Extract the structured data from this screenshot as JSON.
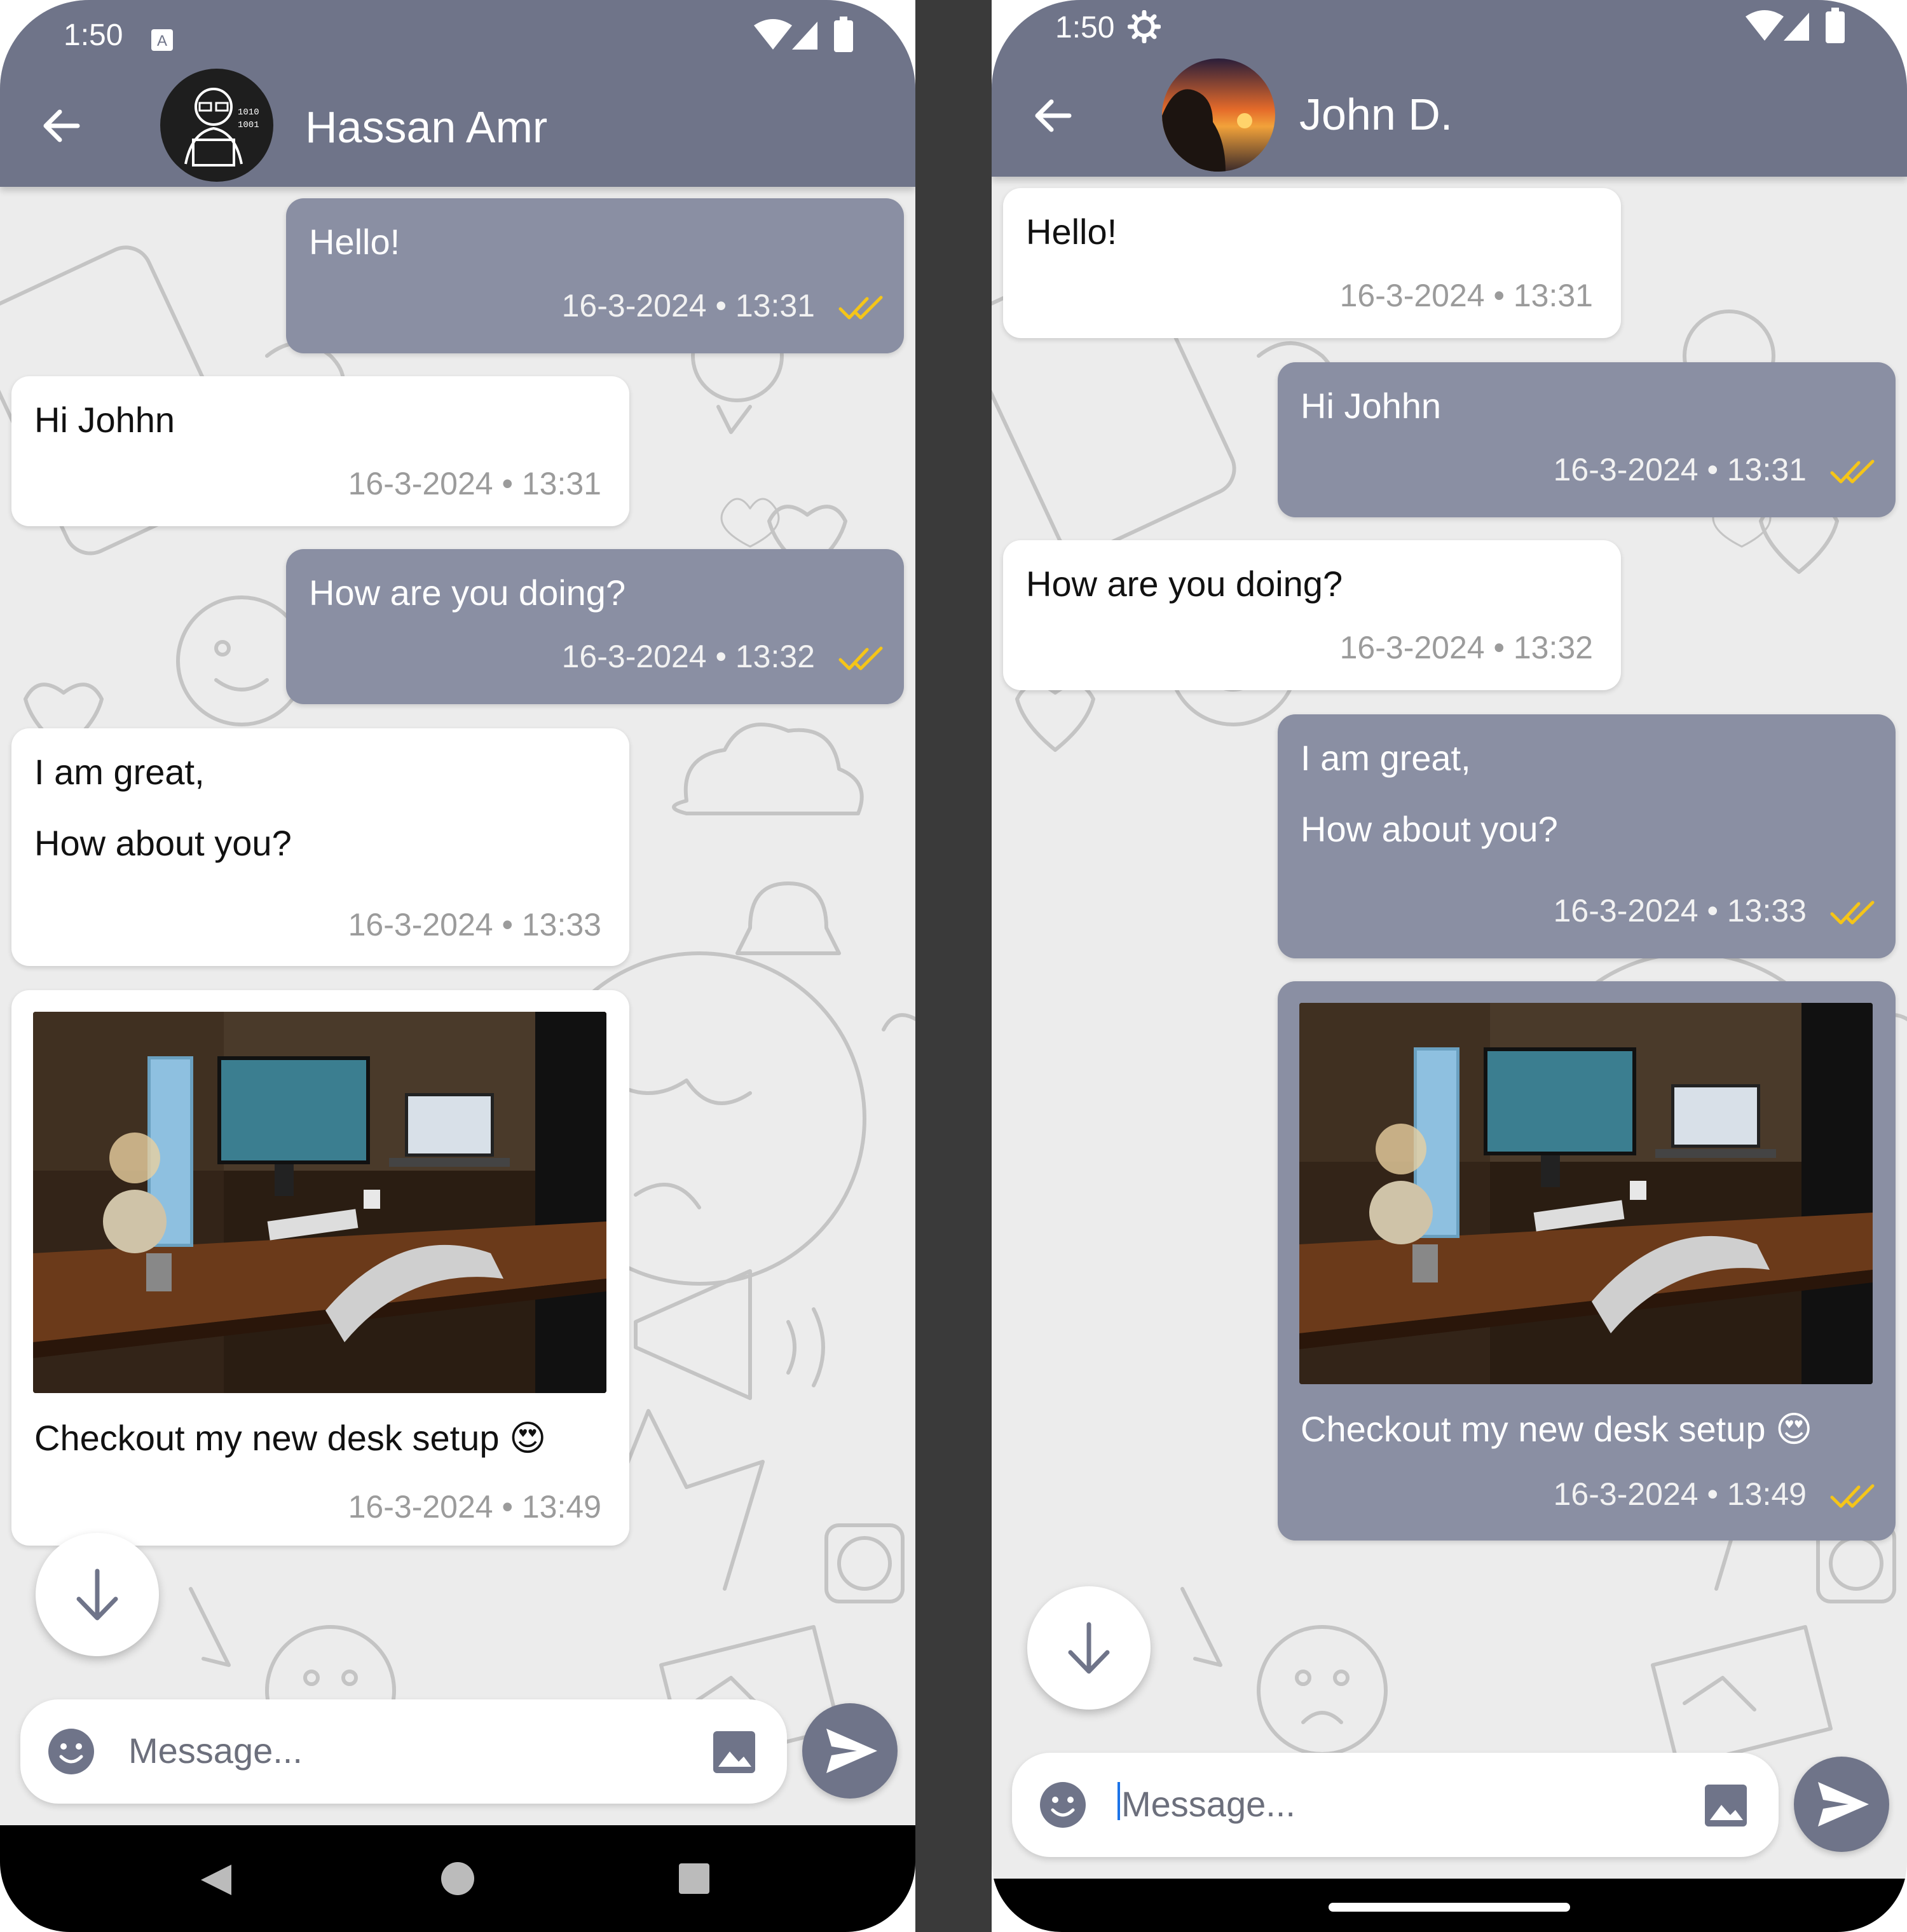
{
  "left": {
    "status": {
      "time": "1:50",
      "notif_icon": "a-notification-icon"
    },
    "header": {
      "contact_name": "Hassan Amr",
      "avatar": "coder-avatar"
    },
    "messages": [
      {
        "dir": "out",
        "text": "Hello!",
        "time": "16-3-2024 • 13:31"
      },
      {
        "dir": "in",
        "text": "Hi Johhn",
        "time": "16-3-2024 • 13:31"
      },
      {
        "dir": "out",
        "text": "How are you doing?",
        "time": "16-3-2024 • 13:32"
      },
      {
        "dir": "in",
        "line1": "I am great,",
        "line2": "How about you?",
        "time": "16-3-2024 • 13:33"
      },
      {
        "dir": "in",
        "image": "desk-setup-photo",
        "caption": "Checkout my new desk setup 😍",
        "time": "16-3-2024 • 13:49"
      }
    ],
    "composer": {
      "placeholder": "Message..."
    }
  },
  "right": {
    "status": {
      "time": "1:50",
      "notif_icon": "gear-icon"
    },
    "header": {
      "contact_name": "John D.",
      "avatar": "sunset-avatar"
    },
    "messages": [
      {
        "dir": "in",
        "text": "Hello!",
        "time": "16-3-2024 • 13:31"
      },
      {
        "dir": "out",
        "text": "Hi Johhn",
        "time": "16-3-2024 • 13:31"
      },
      {
        "dir": "in",
        "text": "How are you doing?",
        "time": "16-3-2024 • 13:32"
      },
      {
        "dir": "out",
        "line1": "I am great,",
        "line2": "How about you?",
        "time": "16-3-2024 • 13:33"
      },
      {
        "dir": "out",
        "image": "desk-setup-photo",
        "caption": "Checkout my new desk setup 😍",
        "time": "16-3-2024 • 13:49"
      }
    ],
    "composer": {
      "placeholder": "Message..."
    }
  },
  "colors": {
    "header": "#6f7489",
    "outgoing_bubble": "#8a8fa3",
    "incoming_bubble": "#ffffff",
    "tick": "#f5c518",
    "background": "#ececec"
  }
}
